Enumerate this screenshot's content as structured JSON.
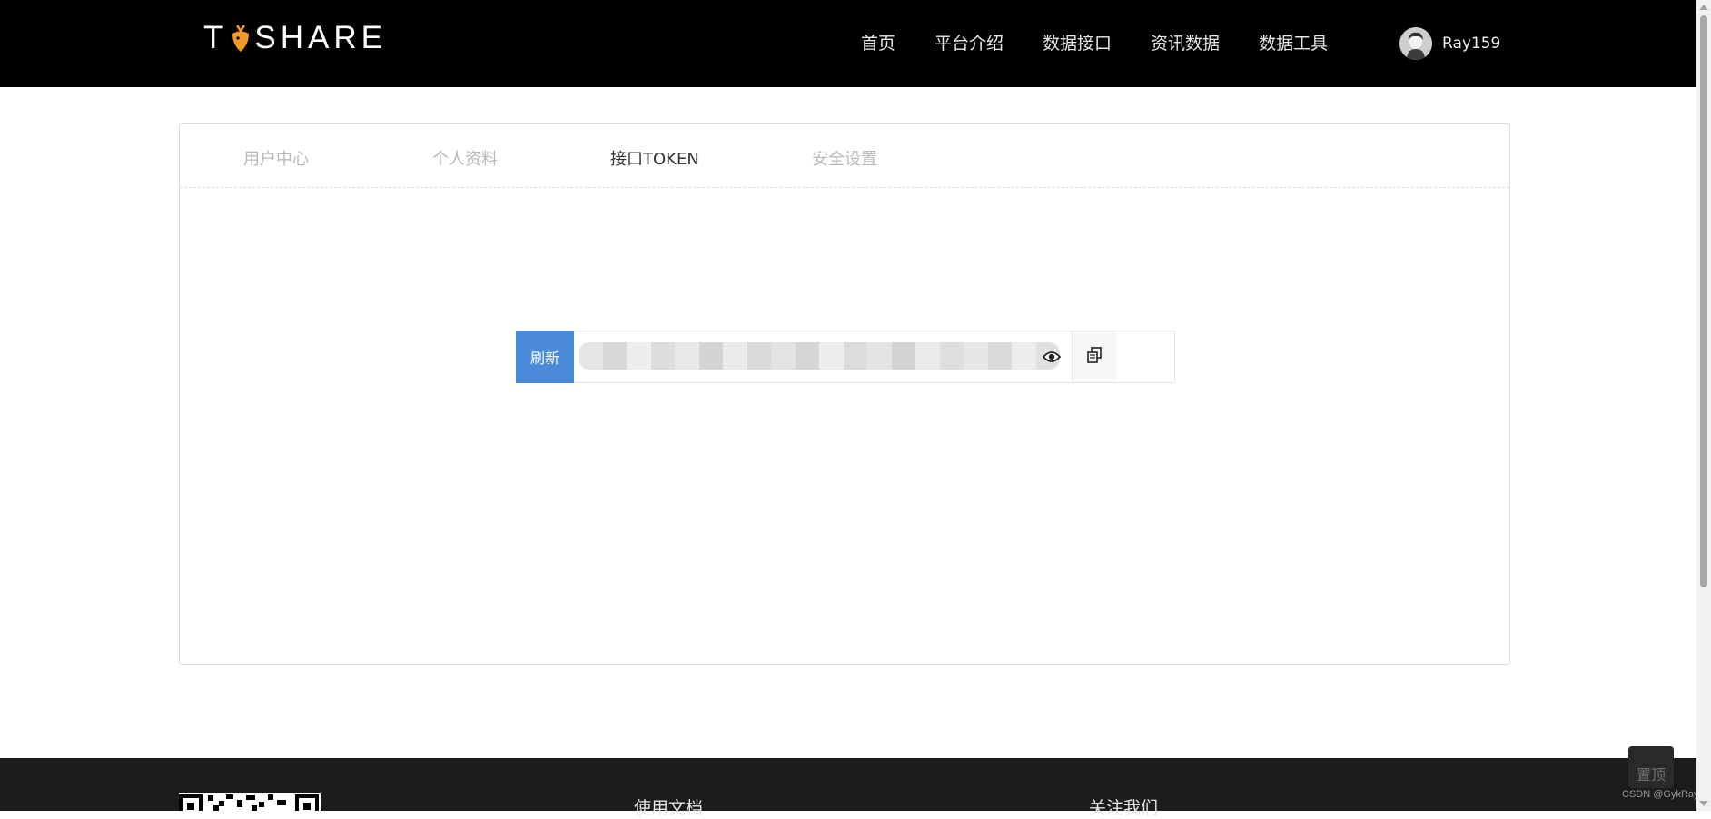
{
  "header": {
    "logo_text_pre": "T",
    "logo_text_post": "SHARE",
    "nav": [
      "首页",
      "平台介绍",
      "数据接口",
      "资讯数据",
      "数据工具"
    ],
    "user": {
      "name": "Ray159"
    }
  },
  "tabs": [
    {
      "label": "用户中心",
      "active": false
    },
    {
      "label": "个人资料",
      "active": false
    },
    {
      "label": "接口TOKEN",
      "active": true
    },
    {
      "label": "安全设置",
      "active": false
    }
  ],
  "token": {
    "refresh_label": "刷新",
    "value_visible": false
  },
  "footer": {
    "col1_title": "使用文档",
    "col2_title": "关注我们",
    "back_to_top": "置顶",
    "watermark": "CSDN @GykRay"
  },
  "colors": {
    "header_bg": "#000000",
    "accent_blue": "#4a8ad8",
    "logo_orange": "#f39a26",
    "footer_bg": "#1c1c1c"
  }
}
